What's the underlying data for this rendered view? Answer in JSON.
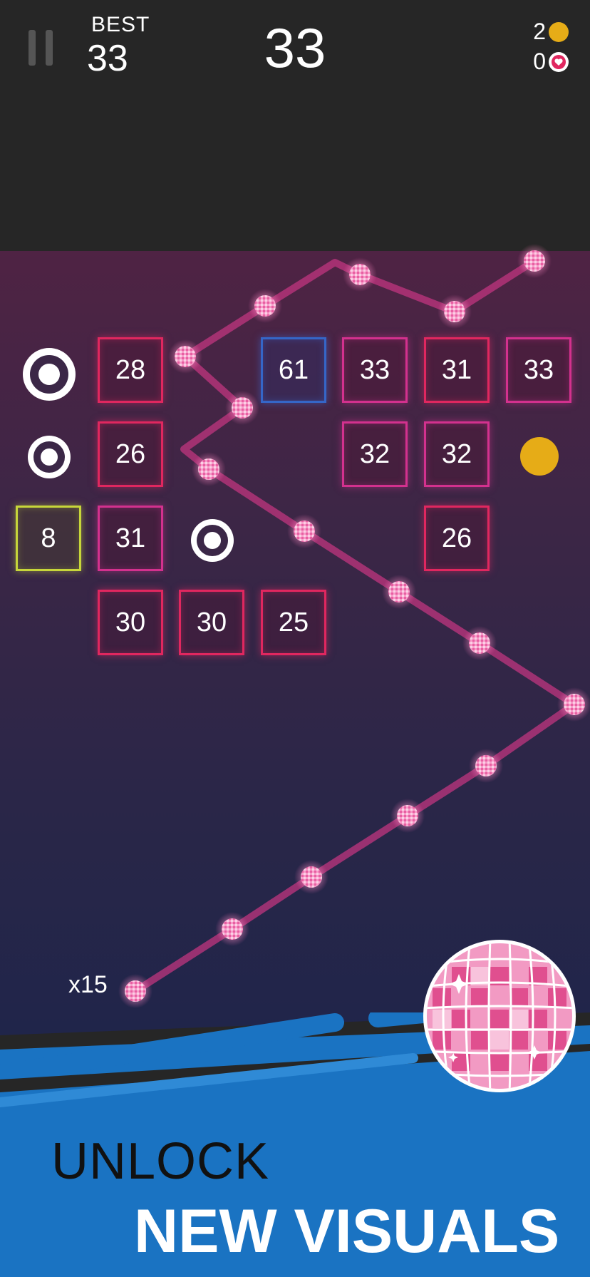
{
  "hud": {
    "best_label": "BEST",
    "best_value": "33",
    "score": "33",
    "coins": "2",
    "hearts": "0",
    "icons": [
      "pause-icon",
      "coin-icon",
      "heart-icon"
    ]
  },
  "board": {
    "blocks": [
      {
        "value": "28",
        "color": "#e0275f"
      },
      {
        "value": "61",
        "color": "#3566c8"
      },
      {
        "value": "33",
        "color": "#d3318e"
      },
      {
        "value": "31",
        "color": "#e0275f"
      },
      {
        "value": "33",
        "color": "#d3318e"
      },
      {
        "value": "26",
        "color": "#e0275f"
      },
      {
        "value": "32",
        "color": "#d3318e"
      },
      {
        "value": "32",
        "color": "#d3318e"
      },
      {
        "value": "8",
        "color": "#c7d63a"
      },
      {
        "value": "31",
        "color": "#d3318e"
      },
      {
        "value": "26",
        "color": "#e0275f"
      },
      {
        "value": "30",
        "color": "#e0275f"
      },
      {
        "value": "30",
        "color": "#e0275f"
      },
      {
        "value": "25",
        "color": "#e0275f"
      }
    ],
    "ball_count": "x15"
  },
  "promo": {
    "line1": "UNLOCK",
    "line2": "NEW VISUALS",
    "accent_color": "#1a73c2"
  }
}
